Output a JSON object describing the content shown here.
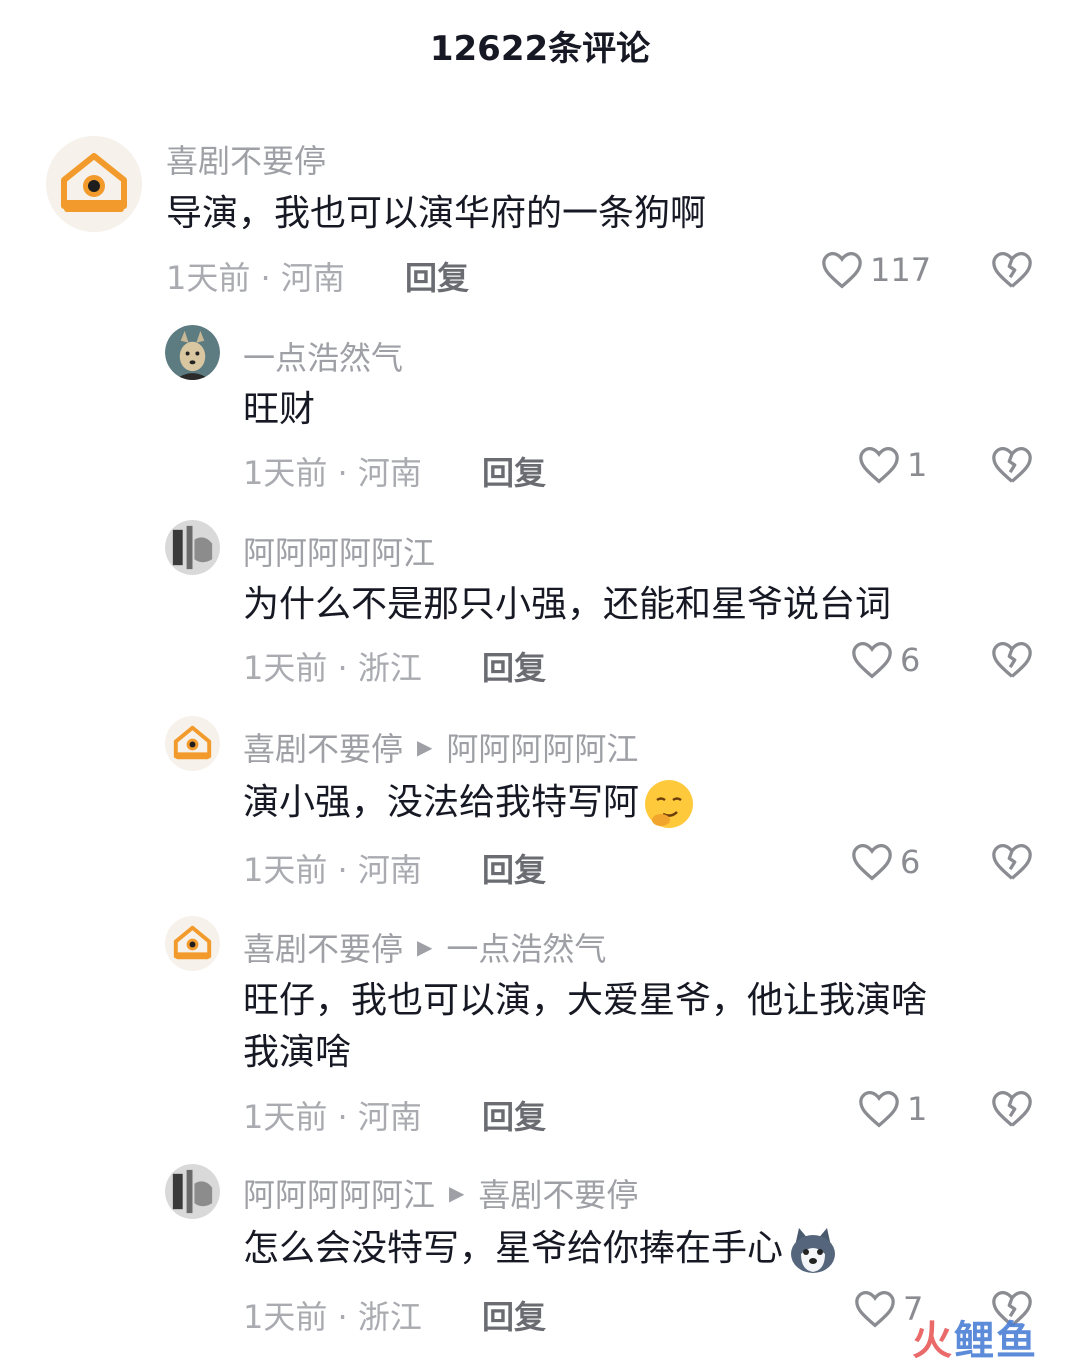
{
  "header": {
    "title": "12622条评论"
  },
  "comments": [
    {
      "author": "喜剧不要停",
      "reply_to": "",
      "text": "导演，我也可以演华府的一条狗啊",
      "meta": "1天前 · 河南",
      "reply_label": "回复",
      "likes": "117",
      "avatar": "orange-house-logo",
      "level": "top"
    },
    {
      "author": "一点浩然气",
      "reply_to": "",
      "text": "旺财",
      "meta": "1天前 · 河南",
      "reply_label": "回复",
      "likes": "1",
      "avatar": "dog-avatar",
      "level": "sub"
    },
    {
      "author": "阿阿阿阿阿江",
      "reply_to": "",
      "text": "为什么不是那只小强，还能和星爷说台词",
      "meta": "1天前 · 浙江",
      "reply_label": "回复",
      "likes": "6",
      "avatar": "bw-photo-avatar",
      "level": "sub"
    },
    {
      "author": "喜剧不要停",
      "reply_to": "阿阿阿阿阿江",
      "text": "演小强，没法给我特写阿",
      "emoji": "smirk-emoji",
      "meta": "1天前 · 河南",
      "reply_label": "回复",
      "likes": "6",
      "avatar": "orange-house-logo",
      "level": "sub"
    },
    {
      "author": "喜剧不要停",
      "reply_to": "一点浩然气",
      "text_line1": "旺仔，我也可以演，大爱星爷，他让我演啥",
      "text_line2": "我演啥",
      "meta": "1天前 · 河南",
      "reply_label": "回复",
      "likes": "1",
      "avatar": "orange-house-logo",
      "level": "sub"
    },
    {
      "author": "阿阿阿阿阿江",
      "reply_to": "喜剧不要停",
      "text": "怎么会没特写，星爷给你捧在手心",
      "emoji": "husky-emoji",
      "meta": "1天前 · 浙江",
      "reply_label": "回复",
      "likes": "7",
      "avatar": "bw-photo-avatar",
      "level": "sub"
    }
  ],
  "watermark": {
    "part1": "火",
    "part2": "鲤鱼"
  },
  "colors": {
    "accent": "#f29b2c",
    "muted_text": "#9ea0a6",
    "body_text": "#161823"
  }
}
